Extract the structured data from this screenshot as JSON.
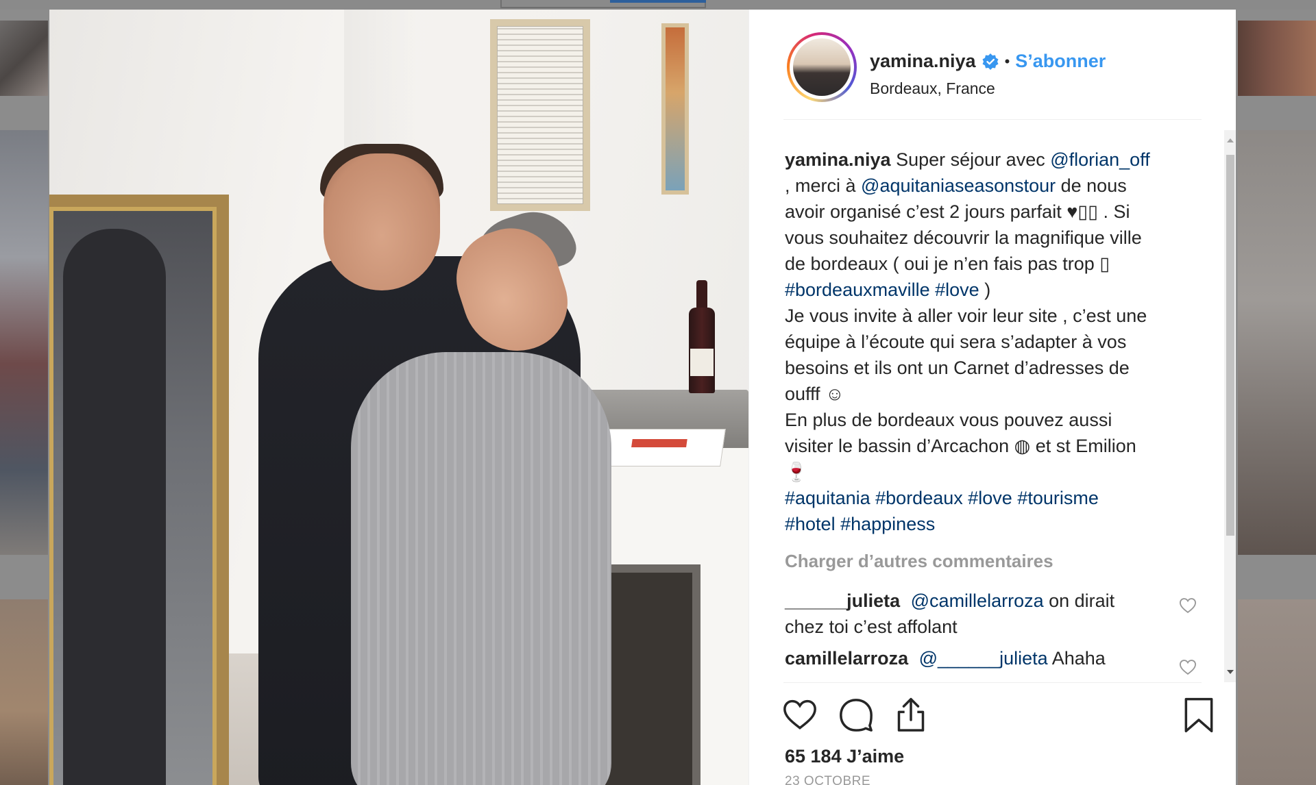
{
  "post": {
    "username": "yamina.niya",
    "separator": "•",
    "follow_label": "S’abonner",
    "location": "Bordeaux, France",
    "caption": {
      "author": "yamina.niya",
      "lines": [
        [
          {
            "t": "text",
            "v": "Super séjour avec "
          },
          {
            "t": "mention",
            "v": "@florian_off"
          }
        ],
        [
          {
            "t": "text",
            "v": ", merci à "
          },
          {
            "t": "mention",
            "v": "@aquitaniaseasonstour"
          },
          {
            "t": "text",
            "v": " de nous"
          }
        ],
        [
          {
            "t": "text",
            "v": "avoir organisé c’est 2 jours parfait ♥▯▯ . Si"
          }
        ],
        [
          {
            "t": "text",
            "v": "vous souhaitez découvrir la magnifique ville"
          }
        ],
        [
          {
            "t": "text",
            "v": "de bordeaux ( oui je n’en fais pas trop ▯"
          }
        ],
        [
          {
            "t": "hashtag",
            "v": "#bordeauxmaville"
          },
          {
            "t": "text",
            "v": " "
          },
          {
            "t": "hashtag",
            "v": "#love"
          },
          {
            "t": "text",
            "v": " )"
          }
        ],
        [
          {
            "t": "text",
            "v": "Je vous invite à aller voir leur site , c’est une"
          }
        ],
        [
          {
            "t": "text",
            "v": "équipe à l’écoute qui sera s’adapter à vos"
          }
        ],
        [
          {
            "t": "text",
            "v": "besoins et ils ont un Carnet d’adresses de"
          }
        ],
        [
          {
            "t": "text",
            "v": "oufff ☺"
          }
        ],
        [
          {
            "t": "text",
            "v": "En plus de bordeaux vous pouvez aussi"
          }
        ],
        [
          {
            "t": "text",
            "v": "visiter le bassin d’Arcachon ◍ et st Emilion"
          }
        ],
        [
          {
            "t": "text",
            "v": "🍷"
          }
        ],
        [
          {
            "t": "hashtag",
            "v": "#aquitania"
          },
          {
            "t": "text",
            "v": " "
          },
          {
            "t": "hashtag",
            "v": "#bordeaux"
          },
          {
            "t": "text",
            "v": " "
          },
          {
            "t": "hashtag",
            "v": "#love"
          },
          {
            "t": "text",
            "v": " "
          },
          {
            "t": "hashtag",
            "v": "#tourisme"
          }
        ],
        [
          {
            "t": "hashtag",
            "v": "#hotel"
          },
          {
            "t": "text",
            "v": " "
          },
          {
            "t": "hashtag",
            "v": "#happiness"
          }
        ]
      ]
    },
    "load_more_label": "Charger d’autres commentaires",
    "comments": [
      {
        "author": "______julieta",
        "mention": "@camillelarroza",
        "text": " on dirait",
        "text2": "chez toi c’est affolant"
      },
      {
        "author": "camillelarroza",
        "mention": "@______julieta",
        "text": " Ahaha",
        "text2": ""
      }
    ],
    "likes": "65 184 J’aime",
    "date": "23 OCTOBRE"
  },
  "icons": {
    "verified": "verified-badge-icon",
    "like": "heart-icon",
    "comment": "comment-bubble-icon",
    "share": "share-icon",
    "save": "bookmark-icon"
  },
  "colors": {
    "link": "#3897f0",
    "mention": "#003569",
    "muted": "#999999",
    "text": "#262626"
  }
}
